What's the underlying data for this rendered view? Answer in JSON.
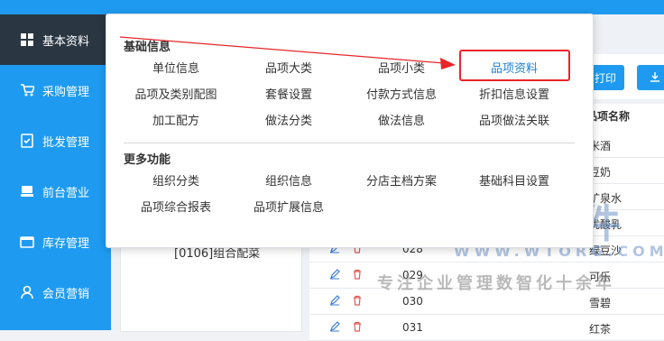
{
  "sidebar": {
    "items": [
      {
        "label": "基本资料",
        "icon": "grid-icon",
        "active": true
      },
      {
        "label": "采购管理",
        "icon": "cart-icon"
      },
      {
        "label": "批发管理",
        "icon": "check-doc-icon"
      },
      {
        "label": "前台营业",
        "icon": "register-icon"
      },
      {
        "label": "库存管理",
        "icon": "warehouse-icon"
      },
      {
        "label": "会员营销",
        "icon": "user-icon"
      }
    ]
  },
  "popup": {
    "section1_title": "基础信息",
    "section1_items": [
      "单位信息",
      "品项大类",
      "品项小类",
      "品项资料",
      "品项及类别配图",
      "套餐设置",
      "付款方式信息",
      "折扣信息设置",
      "加工配方",
      "做法分类",
      "做法信息",
      "品项做法关联"
    ],
    "section2_title": "更多功能",
    "section2_items": [
      "组织分类",
      "组织信息",
      "分店主档方案",
      "基础科目设置",
      "品项综合报表",
      "品项扩展信息"
    ]
  },
  "toolbar": {
    "print_label": "打印",
    "export_icon": "download-icon"
  },
  "tree": {
    "node_label": "[0106]组合配菜"
  },
  "grid": {
    "header_name": "品项名称",
    "rows": [
      {
        "code": "",
        "name": "米酒"
      },
      {
        "code": "",
        "name": "豆奶"
      },
      {
        "code": "",
        "name": "矿泉水"
      },
      {
        "code": "",
        "name": "优酸乳"
      },
      {
        "code": "028",
        "name": "绿豆沙"
      },
      {
        "code": "029",
        "name": "可乐"
      },
      {
        "code": "030",
        "name": "雪碧"
      },
      {
        "code": "031",
        "name": "红茶"
      }
    ]
  },
  "watermark": {
    "brand": "五通软件",
    "url": "WWW.WTORG.COM",
    "slogan": "专注企业管理数智化十余年"
  },
  "colors": {
    "sidebar_bg": "#1e9bf0",
    "sidebar_active": "#2b3643",
    "highlight_border": "#e6262a"
  }
}
